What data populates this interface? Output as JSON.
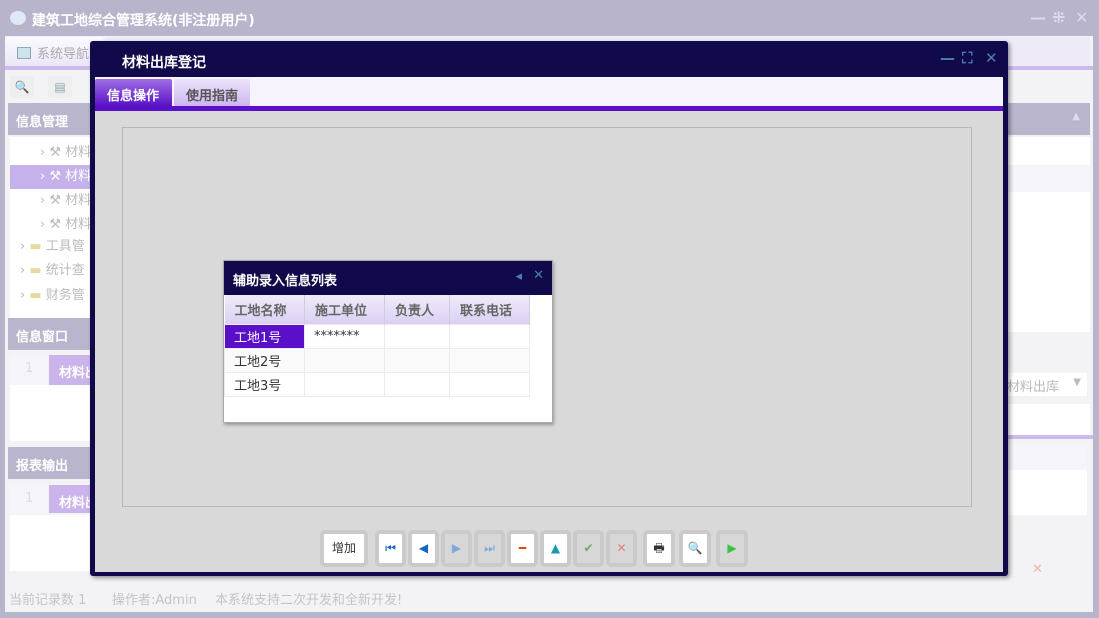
{
  "app": {
    "title": "建筑工地综合管理系统(非注册用户)"
  },
  "tabs": [
    {
      "label": "系统导航"
    }
  ],
  "left": {
    "info_mgmt": "信息管理",
    "tree": [
      {
        "label": "材料"
      },
      {
        "label": "材料"
      },
      {
        "label": "材料"
      },
      {
        "label": "材料"
      },
      {
        "label": "工具管"
      },
      {
        "label": "统计查"
      },
      {
        "label": "财务管"
      }
    ],
    "info_window": "信息窗口",
    "info_row": {
      "num": "1",
      "label": "材料出"
    },
    "report": "报表输出",
    "report_row": {
      "num": "1",
      "label": "材料出"
    }
  },
  "right": {
    "select_value": "材料出库"
  },
  "status": {
    "records": "当前记录数 1",
    "operator": "操作者:Admin",
    "note": "本系统支持二次开发和全新开发!"
  },
  "modal": {
    "title": "材料出库登记",
    "tabs": [
      "信息操作",
      "使用指南"
    ],
    "popup": {
      "title": "辅助录入信息列表",
      "columns": [
        "工地名称",
        "施工单位",
        "负责人",
        "联系电话"
      ],
      "rows": [
        [
          "工地1号",
          "*******",
          "",
          ""
        ],
        [
          "工地2号",
          "",
          "",
          ""
        ],
        [
          "工地3号",
          "",
          "",
          ""
        ]
      ]
    },
    "buttons": {
      "add": "增加"
    }
  }
}
